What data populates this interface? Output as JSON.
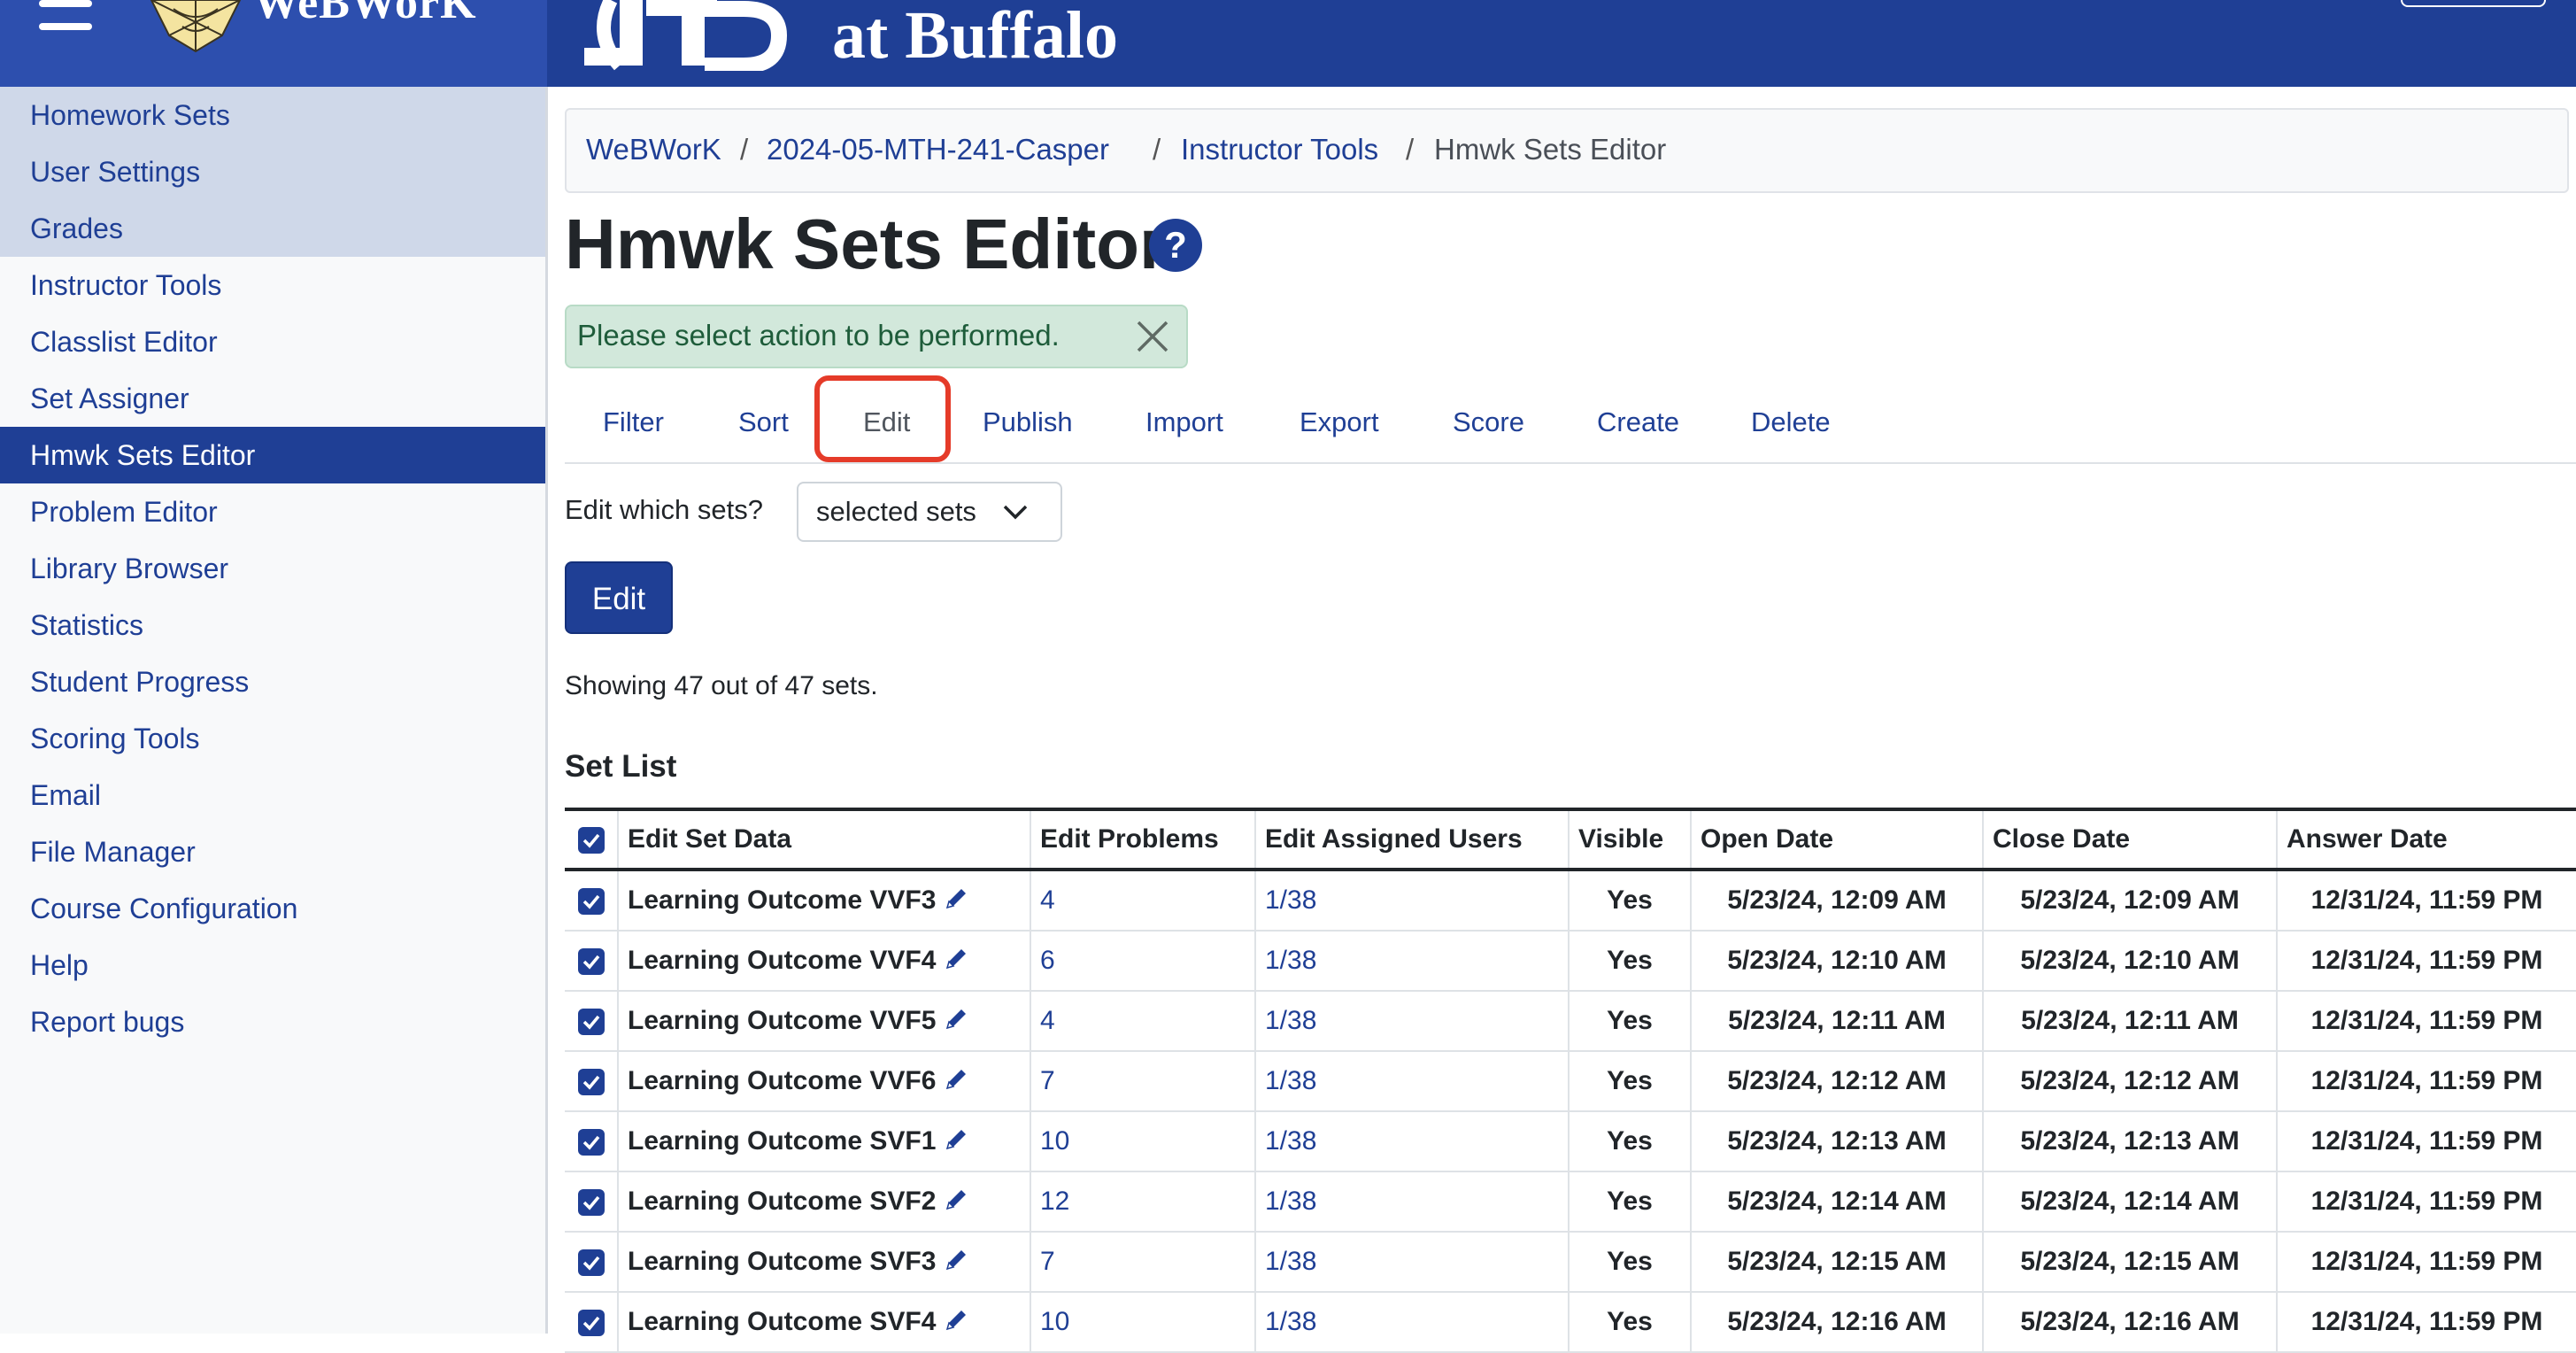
{
  "header": {
    "logo_text": "WeBWorK",
    "university_text": "at Buffalo"
  },
  "sidebar": {
    "items": [
      {
        "label": "Homework Sets"
      },
      {
        "label": "User Settings"
      },
      {
        "label": "Grades"
      },
      {
        "label": "Instructor Tools"
      },
      {
        "label": "Classlist Editor"
      },
      {
        "label": "Set Assigner"
      },
      {
        "label": "Hmwk Sets Editor"
      },
      {
        "label": "Problem Editor"
      },
      {
        "label": "Library Browser"
      },
      {
        "label": "Statistics"
      },
      {
        "label": "Student Progress"
      },
      {
        "label": "Scoring Tools"
      },
      {
        "label": "Email"
      },
      {
        "label": "File Manager"
      },
      {
        "label": "Course Configuration"
      },
      {
        "label": "Help"
      },
      {
        "label": "Report bugs"
      }
    ],
    "active_item": "Hmwk Sets Editor"
  },
  "breadcrumb": {
    "items": [
      "WeBWorK",
      "2024-05-MTH-241-Casper",
      "Instructor Tools",
      "Hmwk Sets Editor"
    ],
    "separator": "/"
  },
  "page": {
    "title": "Hmwk Sets Editor",
    "help_label": "?",
    "alert_message": "Please select action to be performed."
  },
  "tabs": {
    "items": [
      "Filter",
      "Sort",
      "Edit",
      "Publish",
      "Import",
      "Export",
      "Score",
      "Create",
      "Delete"
    ],
    "active": "Edit"
  },
  "edit_form": {
    "label": "Edit which sets?",
    "selected_option": "selected sets",
    "button_label": "Edit"
  },
  "status": {
    "showing": "Showing 47 out of 47 sets."
  },
  "set_list": {
    "title": "Set List",
    "columns": [
      "Edit Set Data",
      "Edit Problems",
      "Edit Assigned Users",
      "Visible",
      "Open Date",
      "Close Date",
      "Answer Date"
    ],
    "rows": [
      {
        "name": "Learning Outcome VVF3",
        "problems": "4",
        "users": "1/38",
        "visible": "Yes",
        "open": "5/23/24, 12:09 AM",
        "close": "5/23/24, 12:09 AM",
        "answer": "12/31/24, 11:59 PM",
        "checked": true
      },
      {
        "name": "Learning Outcome VVF4",
        "problems": "6",
        "users": "1/38",
        "visible": "Yes",
        "open": "5/23/24, 12:10 AM",
        "close": "5/23/24, 12:10 AM",
        "answer": "12/31/24, 11:59 PM",
        "checked": true
      },
      {
        "name": "Learning Outcome VVF5",
        "problems": "4",
        "users": "1/38",
        "visible": "Yes",
        "open": "5/23/24, 12:11 AM",
        "close": "5/23/24, 12:11 AM",
        "answer": "12/31/24, 11:59 PM",
        "checked": true
      },
      {
        "name": "Learning Outcome VVF6",
        "problems": "7",
        "users": "1/38",
        "visible": "Yes",
        "open": "5/23/24, 12:12 AM",
        "close": "5/23/24, 12:12 AM",
        "answer": "12/31/24, 11:59 PM",
        "checked": true
      },
      {
        "name": "Learning Outcome SVF1",
        "problems": "10",
        "users": "1/38",
        "visible": "Yes",
        "open": "5/23/24, 12:13 AM",
        "close": "5/23/24, 12:13 AM",
        "answer": "12/31/24, 11:59 PM",
        "checked": true
      },
      {
        "name": "Learning Outcome SVF2",
        "problems": "12",
        "users": "1/38",
        "visible": "Yes",
        "open": "5/23/24, 12:14 AM",
        "close": "5/23/24, 12:14 AM",
        "answer": "12/31/24, 11:59 PM",
        "checked": true
      },
      {
        "name": "Learning Outcome SVF3",
        "problems": "7",
        "users": "1/38",
        "visible": "Yes",
        "open": "5/23/24, 12:15 AM",
        "close": "5/23/24, 12:15 AM",
        "answer": "12/31/24, 11:59 PM",
        "checked": true
      },
      {
        "name": "Learning Outcome SVF4",
        "problems": "10",
        "users": "1/38",
        "visible": "Yes",
        "open": "5/23/24, 12:16 AM",
        "close": "5/23/24, 12:16 AM",
        "answer": "12/31/24, 11:59 PM",
        "checked": true
      }
    ]
  },
  "colors": {
    "brand_dark": "#1f3f95",
    "alert_bg": "#d2e8db",
    "highlight": "#e53b29"
  }
}
